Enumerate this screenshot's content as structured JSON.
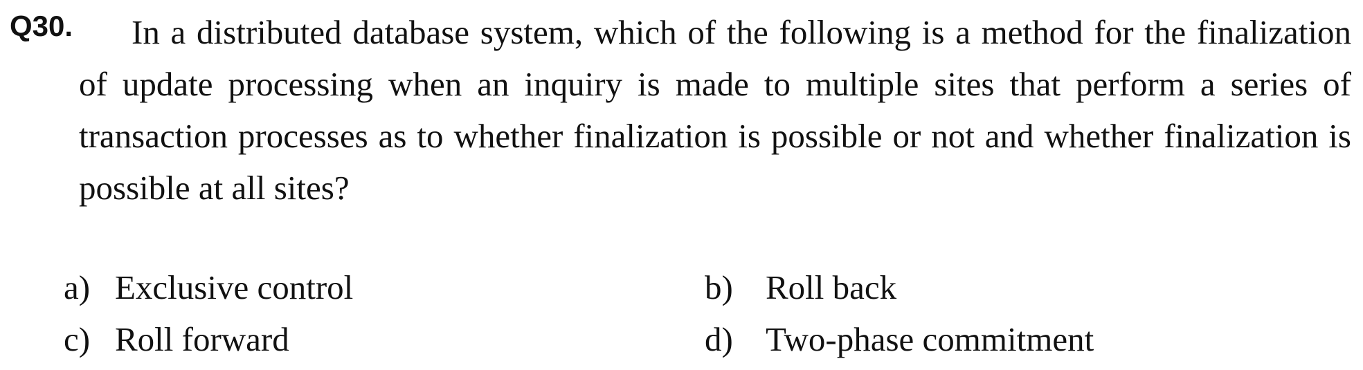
{
  "question": {
    "number": "Q30.",
    "text": "In a distributed database system, which of the following is a method for the finalization of update processing when an inquiry is made to multiple sites that perform a series of transaction processes as to whether finalization is possible or not and whether finalization is possible at all sites?"
  },
  "options": [
    {
      "label": "a)",
      "text": "Exclusive control"
    },
    {
      "label": "b)",
      "text": "Roll back"
    },
    {
      "label": "c)",
      "text": "Roll forward"
    },
    {
      "label": "d)",
      "text": "Two-phase commitment"
    }
  ]
}
